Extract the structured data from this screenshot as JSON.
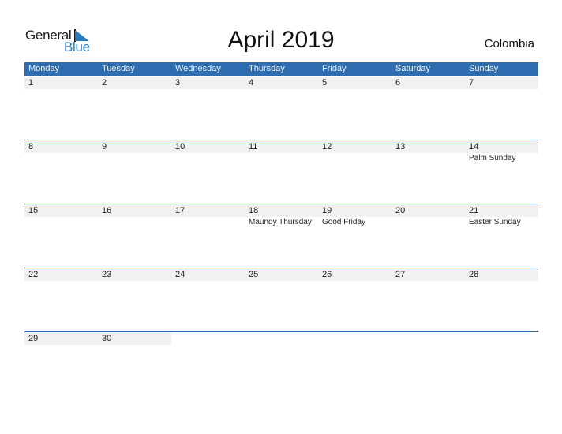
{
  "logo": {
    "word1": "General",
    "word2": "Blue"
  },
  "title": "April 2019",
  "country": "Colombia",
  "colors": {
    "header": "#2e6db0",
    "accent": "#2a7ac0",
    "date_strip": "#f1f1f1"
  },
  "weekdays": [
    "Monday",
    "Tuesday",
    "Wednesday",
    "Thursday",
    "Friday",
    "Saturday",
    "Sunday"
  ],
  "weeks": [
    {
      "days": [
        {
          "date": "1",
          "holiday": ""
        },
        {
          "date": "2",
          "holiday": ""
        },
        {
          "date": "3",
          "holiday": ""
        },
        {
          "date": "4",
          "holiday": ""
        },
        {
          "date": "5",
          "holiday": ""
        },
        {
          "date": "6",
          "holiday": ""
        },
        {
          "date": "7",
          "holiday": ""
        }
      ]
    },
    {
      "days": [
        {
          "date": "8",
          "holiday": ""
        },
        {
          "date": "9",
          "holiday": ""
        },
        {
          "date": "10",
          "holiday": ""
        },
        {
          "date": "11",
          "holiday": ""
        },
        {
          "date": "12",
          "holiday": ""
        },
        {
          "date": "13",
          "holiday": ""
        },
        {
          "date": "14",
          "holiday": "Palm Sunday"
        }
      ]
    },
    {
      "days": [
        {
          "date": "15",
          "holiday": ""
        },
        {
          "date": "16",
          "holiday": ""
        },
        {
          "date": "17",
          "holiday": ""
        },
        {
          "date": "18",
          "holiday": "Maundy Thursday"
        },
        {
          "date": "19",
          "holiday": "Good Friday"
        },
        {
          "date": "20",
          "holiday": ""
        },
        {
          "date": "21",
          "holiday": "Easter Sunday"
        }
      ]
    },
    {
      "days": [
        {
          "date": "22",
          "holiday": ""
        },
        {
          "date": "23",
          "holiday": ""
        },
        {
          "date": "24",
          "holiday": ""
        },
        {
          "date": "25",
          "holiday": ""
        },
        {
          "date": "26",
          "holiday": ""
        },
        {
          "date": "27",
          "holiday": ""
        },
        {
          "date": "28",
          "holiday": ""
        }
      ]
    },
    {
      "days": [
        {
          "date": "29",
          "holiday": ""
        },
        {
          "date": "30",
          "holiday": ""
        },
        {
          "date": "",
          "holiday": ""
        },
        {
          "date": "",
          "holiday": ""
        },
        {
          "date": "",
          "holiday": ""
        },
        {
          "date": "",
          "holiday": ""
        },
        {
          "date": "",
          "holiday": ""
        }
      ]
    }
  ]
}
